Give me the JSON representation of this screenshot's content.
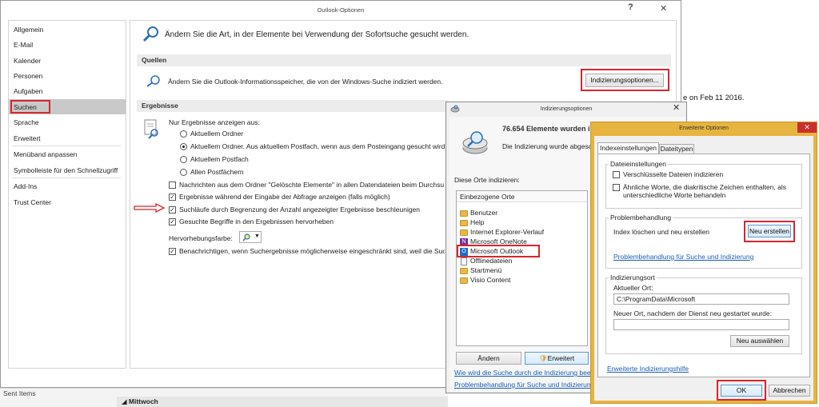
{
  "outlook_options": {
    "title": "Outlook-Optionen",
    "help": "?",
    "close": "✕",
    "nav": [
      "Allgemein",
      "E-Mail",
      "Kalender",
      "Personen",
      "Aufgaben",
      "Suchen",
      "Sprache",
      "Erweitert",
      "Menüband anpassen",
      "Symbolleiste für den Schnellzugriff",
      "Add-Ins",
      "Trust Center"
    ],
    "selected_nav": "Suchen",
    "header_text": "Ändern Sie die Art, in der Elemente bei Verwendung der Sofortsuche gesucht werden.",
    "quellen": {
      "heading": "Quellen",
      "text": "Ändern Sie die Outlook-Informationsspeicher, die von der Windows-Suche indiziert werden.",
      "button": "Indizierungsoptionen..."
    },
    "ergebnisse": {
      "heading": "Ergebnisse",
      "scope_label": "Nur Ergebnisse anzeigen aus:",
      "radios": [
        "Aktuellem Ordner",
        "Aktuellem Ordner. Aus aktuellem Postfach, wenn aus dem Posteingang gesucht wird",
        "Aktuellem Postfach",
        "Allen Postfächern"
      ],
      "checks": [
        {
          "label": "Nachrichten aus dem Ordner \"Gelöschte Elemente\" in allen Datendateien beim Durchsu",
          "checked": false
        },
        {
          "label": "Ergebnisse während der Eingabe der Abfrage anzeigen (falls möglich)",
          "checked": true
        },
        {
          "label": "Suchläufe durch Begrenzung der Anzahl angezeigter Ergebnisse beschleunigen",
          "checked": true
        },
        {
          "label": "Gesuchte Begriffe in den Ergebnissen hervorheben",
          "checked": true
        }
      ],
      "highlight_label": "Hervorhebungsfarbe:",
      "notify_label": "Benachrichtigen, wenn Suchergebnisse möglicherweise eingeschränkt sind, weil die Suc",
      "notify_checked": true
    }
  },
  "index_options": {
    "title": "Indizierungsoptionen",
    "close": "✕",
    "count_text": "76.654 Elemente wurden indizi",
    "status_text": "Die Indizierung wurde abgeschl",
    "locations_label": "Diese Orte indizieren:",
    "list_header": "Einbezogene Orte",
    "locations": [
      "Benutzer",
      "Help",
      "Internet Explorer-Verlauf",
      "Microsoft OneNote",
      "Microsoft Outlook",
      "Offlinedateien",
      "Startmenü",
      "Visio Content"
    ],
    "modify_button": "Ändern",
    "advanced_button": "Erweitert",
    "link1": "Wie wird die Suche durch die Indizierung beeinflu",
    "link2": "Problembehandlung für Suche und Indizierung"
  },
  "advanced_options": {
    "title": "Erweiterte Optionen",
    "close": "✕",
    "tabs": [
      "Indexeinstellungen",
      "Dateitypen"
    ],
    "file_settings_label": "Dateieinstellungen",
    "check1": "Verschlüsselte Dateien indizieren",
    "check2_line1": "Ähnliche Worte, die diakritische Zeichen enthalten, als",
    "check2_line2": "unterschiedliche Worte behandeln",
    "troubleshoot_label": "Problembehandlung",
    "rebuild_text": "Index löschen und neu erstellen",
    "rebuild_button": "Neu erstellen",
    "troubleshoot_link": "Problembehandlung für Suche und Indizierung",
    "location_label": "Indizierungsort",
    "current_location_label": "Aktueller Ort:",
    "current_location_value": "C:\\ProgramData\\Microsoft",
    "new_location_label": "Neuer Ort, nachdem der Dienst neu gestartet wurde:",
    "new_location_value": "",
    "select_new_button": "Neu auswählen",
    "help_link": "Erweiterte Indizierungshilfe",
    "ok": "OK",
    "cancel": "Abbrechen"
  },
  "background": {
    "date_text": "e on Feb 11 2016.",
    "sent_items": "Sent Items",
    "wednesday": "Mittwoch",
    "bracket": "[",
    "dash": "-"
  },
  "colors": {
    "accent_red": "#d6262e",
    "selection_blue": "#cde3f7",
    "dialog_border_gold": "#e7b43f",
    "link_blue": "#1a5fb4"
  }
}
